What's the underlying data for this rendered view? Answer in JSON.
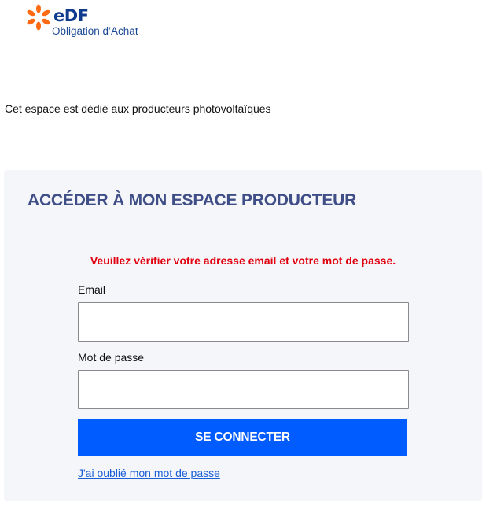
{
  "logo": {
    "brand": "eDF",
    "subtitle": "Obligation d’Achat",
    "colors": {
      "brand_blue": "#0f3b8f",
      "orange": "#ff6a13"
    }
  },
  "intro_text": "Cet espace est dédié aux producteurs photovoltaïques",
  "panel": {
    "title": "ACCÉDER À MON ESPACE PRODUCTEUR",
    "error_message": "Veuillez vérifier votre adresse email et votre mot de passe.",
    "email_label": "Email",
    "email_value": "",
    "password_label": "Mot de passe",
    "password_value": "",
    "submit_label": "SE CONNECTER",
    "forgot_link": "J'ai oublié mon mot de passe"
  },
  "colors": {
    "title": "#3f4e86",
    "error": "#e1000f",
    "button": "#005cff",
    "link": "#1a5fd6",
    "panel_bg": "#f5f6fa"
  }
}
